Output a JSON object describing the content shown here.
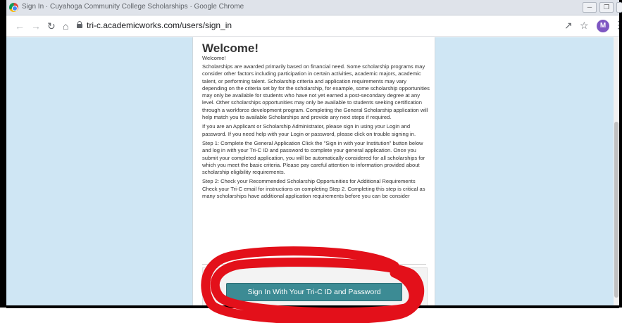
{
  "browser": {
    "window_title": "Sign In · Cuyahoga Community College Scholarships · Google Chrome",
    "url": "tri-c.academicworks.com/users/sign_in",
    "avatar_initial": "M"
  },
  "page": {
    "heading": "Welcome!",
    "subheading": "Welcome!",
    "paragraphs": [
      "Scholarships are awarded primarily based on financial need. Some scholarship programs may consider other factors including participation in certain activities, academic majors, academic talent, or performing talent. Scholarship criteria and application requirements may vary depending on the criteria set by for the scholarship, for example, some scholarship opportunities may only be available for students who have not yet earned a post-secondary degree at any level. Other scholarships opportunities may only be available to students seeking certification through a workforce development program. Completing the General Scholarship application will help match you to available Scholarships and provide any next steps if required.",
      "If you are an Applicant or Scholarship Administrator, please sign in using your Login and password. If you need help with your Login or password, please click on trouble signing in.",
      "Step 1: Complete the General Application Click the \"Sign in with your Institution\" button below and log in with your Tri-C ID and password to complete your general application. Once you submit your completed application, you will be automatically considered for all scholarships for which you meet the basic criteria. Please pay careful attention to information provided about scholarship eligibility requirements.",
      "Step 2: Check your Recommended Scholarship Opportunities for Additional Requirements Check your Tri-C email for instructions on completing Step 2. Completing this step is critical as many scholarships have additional application requirements before you can be consider"
    ],
    "signin_button": "Sign In With Your Tri-C ID and Password"
  },
  "colors": {
    "page_background": "#cfe6f4",
    "button": "#3c8b94",
    "annotation": "#e3101a"
  }
}
